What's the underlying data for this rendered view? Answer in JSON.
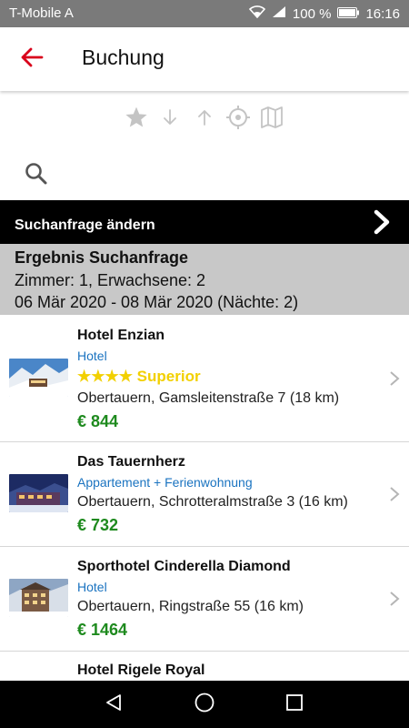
{
  "status_bar": {
    "carrier": "T-Mobile A",
    "battery": "100 %",
    "time": "16:16"
  },
  "app_bar": {
    "title": "Buchung"
  },
  "toolbar": {
    "icons": [
      "star-icon",
      "arrow-down-icon",
      "arrow-up-icon",
      "crosshair-icon",
      "map-icon"
    ]
  },
  "modify_bar": {
    "label": "Suchanfrage ändern"
  },
  "search_result": {
    "heading": "Ergebnis Suchanfrage",
    "line1": "Zimmer: 1, Erwachsene: 2",
    "line2": "06 Mär 2020 - 08 Mär 2020 (Nächte: 2)"
  },
  "hotels": [
    {
      "name": "Hotel Enzian",
      "type": "Hotel",
      "stars": "★★★★ Superior",
      "address": "Obertauern, Gamsleitenstraße 7 (18 km)",
      "price": "€ 844"
    },
    {
      "name": "Das Tauernherz",
      "type": "Appartement + Ferienwohnung",
      "address": "Obertauern, Schrotteralmstraße 3 (16 km)",
      "price": "€ 732"
    },
    {
      "name": "Sporthotel Cinderella Diamond",
      "type": "Hotel",
      "address": "Obertauern, Ringstraße 55 (16 km)",
      "price": "€ 1464"
    },
    {
      "name": "Hotel Rigele Royal"
    }
  ],
  "colors": {
    "accent": "#d9001b",
    "type_blue": "#1a73c0",
    "price_green": "#1e8a1e",
    "stars_yellow": "#f2d000"
  }
}
